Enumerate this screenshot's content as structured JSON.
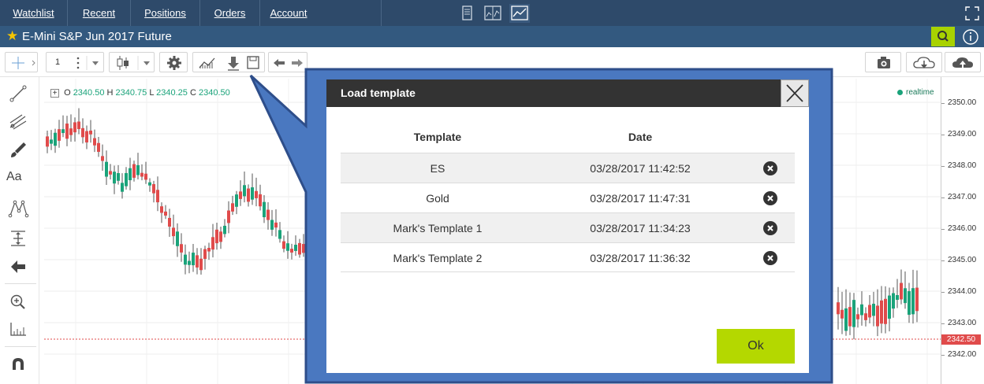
{
  "nav": {
    "tabs": [
      {
        "label": "Watchlist"
      },
      {
        "label": "Recent"
      },
      {
        "label": "Positions"
      },
      {
        "label": "Orders"
      },
      {
        "label": "Account"
      }
    ],
    "icons": [
      "single-panel-icon",
      "split-chart-icon",
      "chart-layout-icon"
    ],
    "expand_icon": "expand-icon"
  },
  "instrument": {
    "title": "E-Mini S&P Jun 2017 Future",
    "favorite_icon": "star-icon"
  },
  "toolbar": {
    "interval_value": "1",
    "icons": [
      "more-vertical-icon",
      "dropdown-icon",
      "candlestick-icon",
      "dropdown-icon",
      "gear-icon",
      "indicators-icon",
      "load-template-icon",
      "save-icon",
      "undo-icon",
      "redo-icon",
      "camera-icon",
      "cloud-download-icon",
      "cloud-upload-icon"
    ]
  },
  "ohlc": {
    "o_label": "O",
    "o": "2340.50",
    "h_label": "H",
    "h": "2340.75",
    "l_label": "L",
    "l": "2340.25",
    "c_label": "C",
    "c": "2340.50"
  },
  "realtime_label": "realtime",
  "y_axis": {
    "ticks": [
      "2350.00",
      "2349.00",
      "2348.00",
      "2347.00",
      "2346.00",
      "2345.00",
      "2344.00",
      "2343.00",
      "2342.00"
    ],
    "current_price": "2342.50"
  },
  "left_tools": [
    "crosshair-icon",
    "trend-line-icon",
    "pitchfork-icon",
    "brush-icon",
    "text-tool-icon",
    "pattern-icon",
    "measure-icon",
    "arrow-icon",
    "zoom-in-icon",
    "ruler-icon",
    "magnet-icon"
  ],
  "text_tool_label": "Aa",
  "modal": {
    "title": "Load template",
    "columns": {
      "template": "Template",
      "date": "Date"
    },
    "rows": [
      {
        "template": "ES",
        "date": "03/28/2017 11:42:52"
      },
      {
        "template": "Gold",
        "date": "03/28/2017 11:47:31"
      },
      {
        "template": "Mark's Template 1",
        "date": "03/28/2017 11:34:23"
      },
      {
        "template": "Mark's Template 2",
        "date": "03/28/2017 11:36:32"
      }
    ],
    "ok_label": "Ok"
  },
  "colors": {
    "nav_bg": "#2e4a6a",
    "title_bg": "#33597f",
    "accent_green": "#a8d200",
    "up_candle": "#1aa37a",
    "down_candle": "#e04b4b",
    "callout_blue": "#4a78c0"
  }
}
